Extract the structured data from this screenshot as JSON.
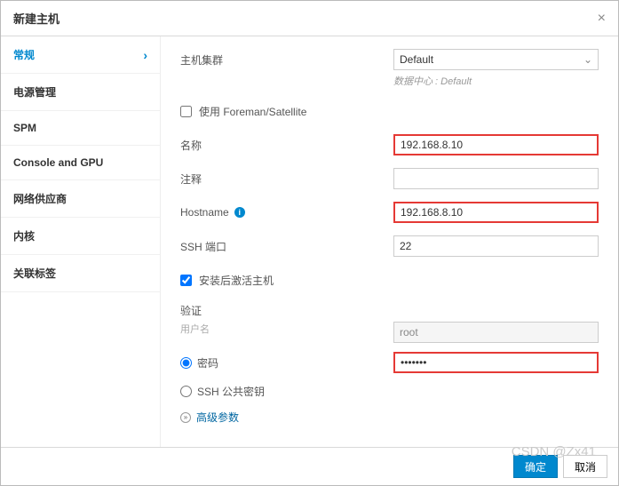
{
  "title": "新建主机",
  "sidebar": {
    "items": [
      {
        "label": "常规",
        "active": true
      },
      {
        "label": "电源管理"
      },
      {
        "label": "SPM"
      },
      {
        "label": "Console and GPU"
      },
      {
        "label": "网络供应商"
      },
      {
        "label": "内核"
      },
      {
        "label": "关联标签"
      }
    ]
  },
  "form": {
    "cluster_label": "主机集群",
    "cluster_value": "Default",
    "dc_hint": "数据中心 : Default",
    "foreman_label": "使用 Foreman/Satellite",
    "foreman_checked": false,
    "name_label": "名称",
    "name_value": "192.168.8.10",
    "comment_label": "注释",
    "comment_value": "",
    "hostname_label": "Hostname",
    "hostname_value": "192.168.8.10",
    "sshport_label": "SSH 端口",
    "sshport_value": "22",
    "activate_label": "安装后激活主机",
    "activate_checked": true,
    "auth_section": "验证",
    "username_label": "用户名",
    "username_value": "root",
    "password_option": "密码",
    "password_value": "•••••••",
    "sshkey_option": "SSH 公共密钥",
    "advanced_label": "高级参数"
  },
  "footer": {
    "ok": "确定",
    "cancel": "取消"
  },
  "watermark": "CSDN @Zx41"
}
